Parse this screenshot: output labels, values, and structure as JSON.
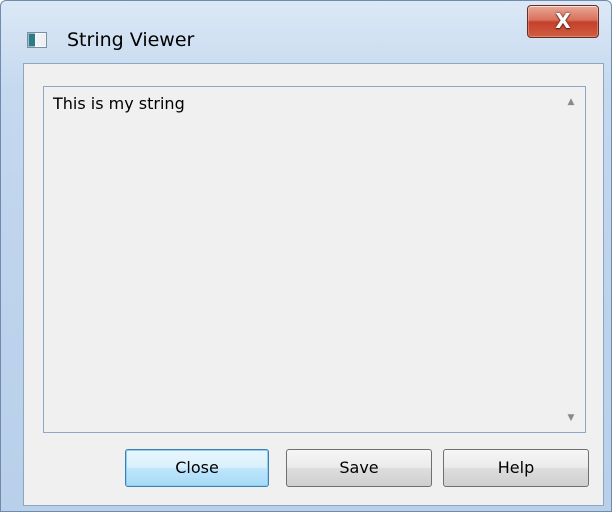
{
  "window": {
    "title": "String Viewer",
    "icon": "app-window-icon",
    "close_glyph": "X",
    "accent_color": "#c4402a",
    "frame_color": "#bdd3ec"
  },
  "viewer": {
    "text": "This is my string",
    "scroll_up_glyph": "▲",
    "scroll_down_glyph": "▼"
  },
  "buttons": {
    "close_label": "Close",
    "save_label": "Save",
    "help_label": "Help"
  }
}
